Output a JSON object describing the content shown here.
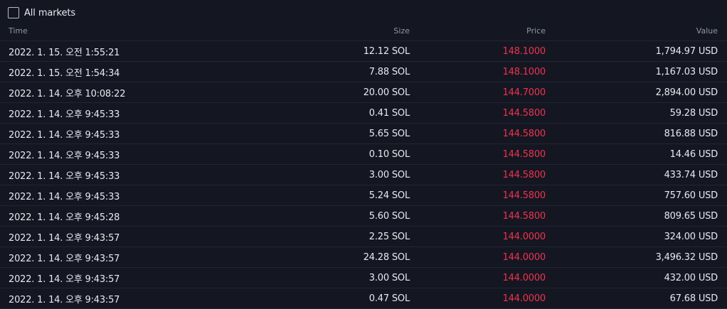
{
  "filter": {
    "all_markets_label": "All markets",
    "all_markets_checked": false
  },
  "table": {
    "headers": {
      "time": "Time",
      "size": "Size",
      "price": "Price",
      "value": "Value"
    },
    "rows": [
      {
        "time": "2022. 1. 15. 오전 1:55:21",
        "size": "12.12 SOL",
        "price": "148.1000",
        "value": "1,794.97 USD"
      },
      {
        "time": "2022. 1. 15. 오전 1:54:34",
        "size": "7.88 SOL",
        "price": "148.1000",
        "value": "1,167.03 USD"
      },
      {
        "time": "2022. 1. 14. 오후 10:08:22",
        "size": "20.00 SOL",
        "price": "144.7000",
        "value": "2,894.00 USD"
      },
      {
        "time": "2022. 1. 14. 오후 9:45:33",
        "size": "0.41 SOL",
        "price": "144.5800",
        "value": "59.28 USD"
      },
      {
        "time": "2022. 1. 14. 오후 9:45:33",
        "size": "5.65 SOL",
        "price": "144.5800",
        "value": "816.88 USD"
      },
      {
        "time": "2022. 1. 14. 오후 9:45:33",
        "size": "0.10 SOL",
        "price": "144.5800",
        "value": "14.46 USD"
      },
      {
        "time": "2022. 1. 14. 오후 9:45:33",
        "size": "3.00 SOL",
        "price": "144.5800",
        "value": "433.74 USD"
      },
      {
        "time": "2022. 1. 14. 오후 9:45:33",
        "size": "5.24 SOL",
        "price": "144.5800",
        "value": "757.60 USD"
      },
      {
        "time": "2022. 1. 14. 오후 9:45:28",
        "size": "5.60 SOL",
        "price": "144.5800",
        "value": "809.65 USD"
      },
      {
        "time": "2022. 1. 14. 오후 9:43:57",
        "size": "2.25 SOL",
        "price": "144.0000",
        "value": "324.00 USD"
      },
      {
        "time": "2022. 1. 14. 오후 9:43:57",
        "size": "24.28 SOL",
        "price": "144.0000",
        "value": "3,496.32 USD"
      },
      {
        "time": "2022. 1. 14. 오후 9:43:57",
        "size": "3.00 SOL",
        "price": "144.0000",
        "value": "432.00 USD"
      },
      {
        "time": "2022. 1. 14. 오후 9:43:57",
        "size": "0.47 SOL",
        "price": "144.0000",
        "value": "67.68 USD"
      }
    ]
  },
  "colors": {
    "background": "#141722",
    "text": "#e7e9ef",
    "header_text": "#8f96a7",
    "sell_price": "#f0324e",
    "row_divider": "#222633"
  }
}
